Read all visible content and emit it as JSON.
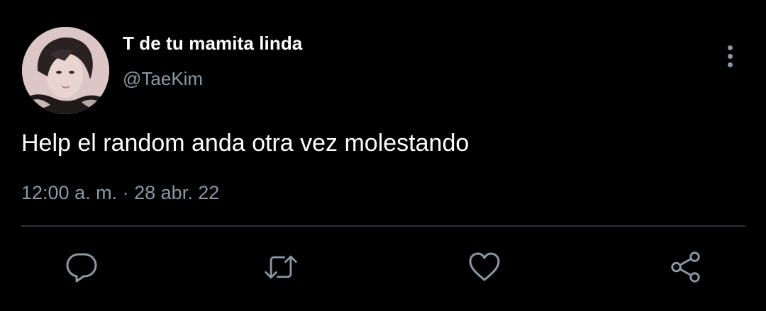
{
  "tweet": {
    "display_name": "T de tu mamita linda",
    "handle": "@TaeKim",
    "text": "Help el random anda otra vez molestando",
    "time": "12:00 a. m.",
    "separator": "·",
    "date": "28 abr. 22"
  },
  "actions": [
    {
      "icon": "reply-icon"
    },
    {
      "icon": "retweet-icon"
    },
    {
      "icon": "like-icon"
    },
    {
      "icon": "share-icon"
    }
  ],
  "colors": {
    "background": "#000000",
    "text_primary": "#ffffff",
    "text_secondary": "#8b98a5",
    "divider": "#2f3336"
  }
}
